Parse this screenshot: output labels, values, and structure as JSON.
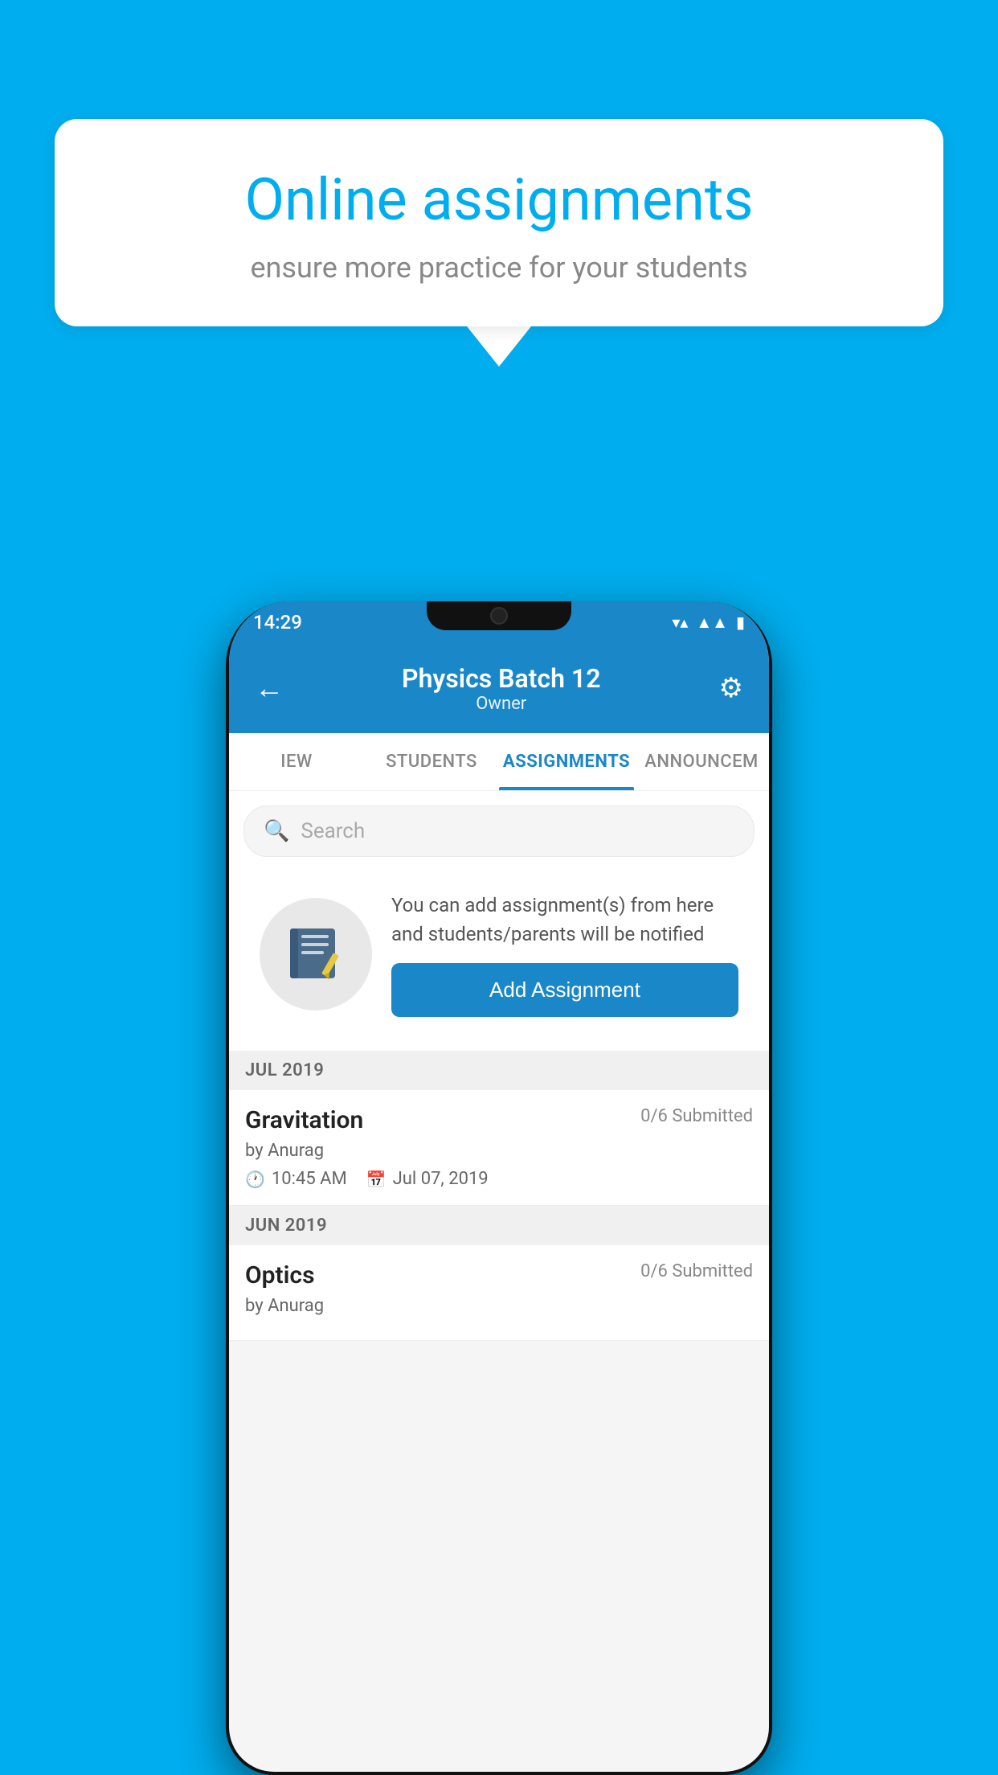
{
  "background_color": "#00AEEF",
  "speech_bubble": {
    "title": "Online assignments",
    "subtitle": "ensure more practice for your students"
  },
  "status_bar": {
    "time": "14:29",
    "wifi": "▾",
    "signal": "▲",
    "battery": "▮"
  },
  "app_bar": {
    "title": "Physics Batch 12",
    "subtitle": "Owner",
    "back_label": "←",
    "settings_label": "⚙"
  },
  "tabs": [
    {
      "label": "IEW",
      "active": false
    },
    {
      "label": "STUDENTS",
      "active": false
    },
    {
      "label": "ASSIGNMENTS",
      "active": true
    },
    {
      "label": "ANNOUNCEM",
      "active": false
    }
  ],
  "search": {
    "placeholder": "Search"
  },
  "promo": {
    "description": "You can add assignment(s) from here and students/parents will be notified",
    "button_label": "Add Assignment"
  },
  "sections": [
    {
      "header": "JUL 2019",
      "assignments": [
        {
          "title": "Gravitation",
          "submitted": "0/6 Submitted",
          "by": "by Anurag",
          "time": "10:45 AM",
          "date": "Jul 07, 2019"
        }
      ]
    },
    {
      "header": "JUN 2019",
      "assignments": [
        {
          "title": "Optics",
          "submitted": "0/6 Submitted",
          "by": "by Anurag",
          "time": "",
          "date": ""
        }
      ]
    }
  ]
}
